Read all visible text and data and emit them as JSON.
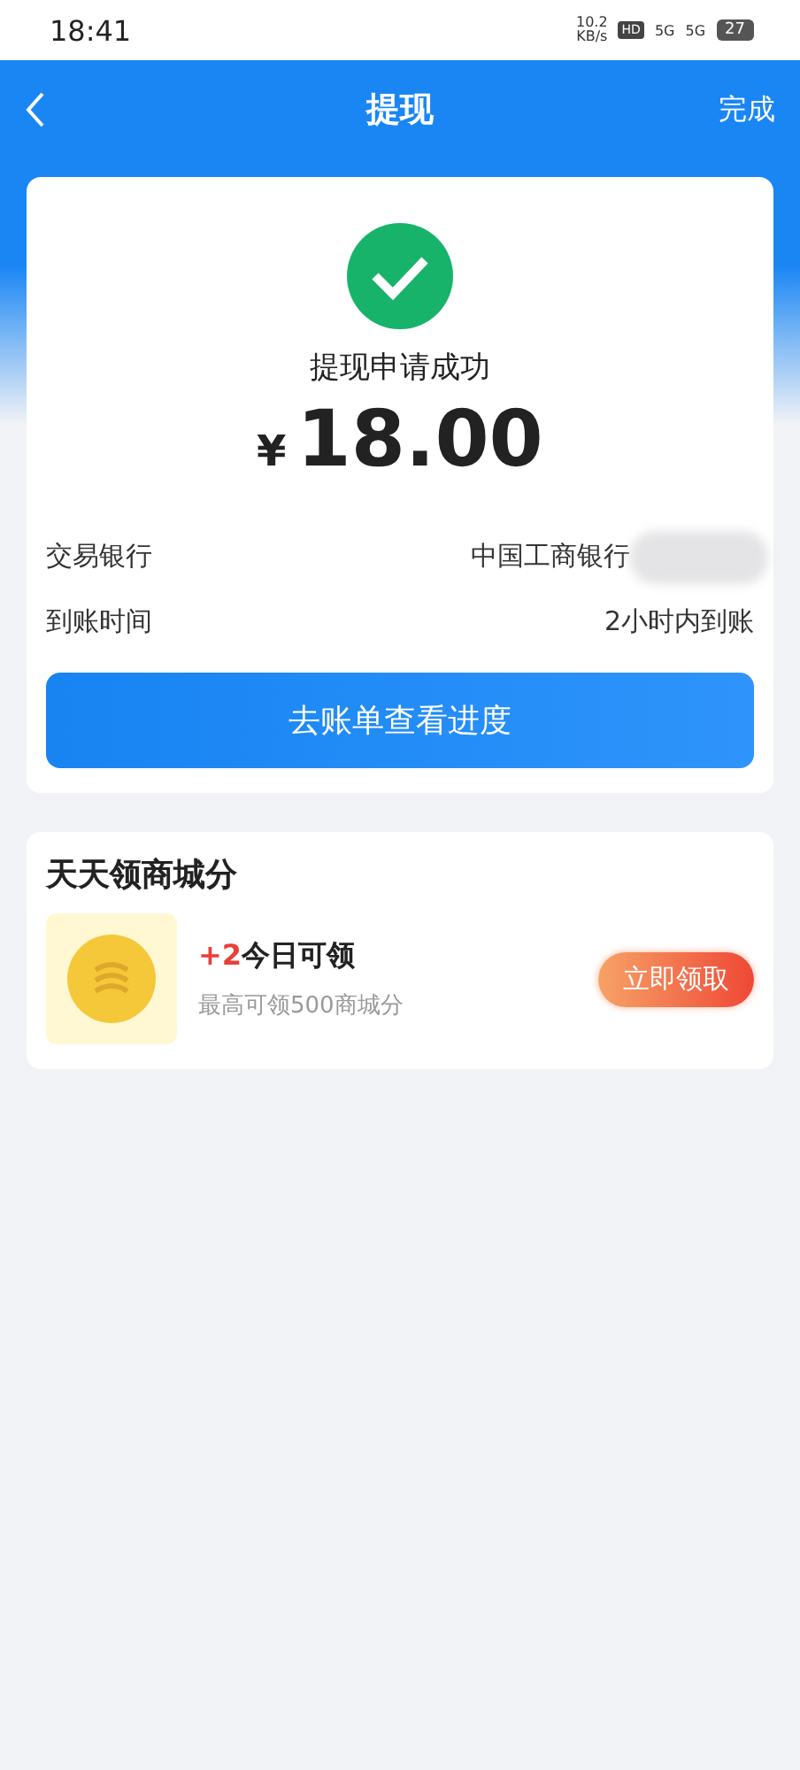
{
  "status_bar": {
    "time": "18:41",
    "speed": "10.2",
    "speed_unit": "KB/s",
    "hd": "HD",
    "signals": [
      "5G",
      "5G"
    ],
    "battery": "27"
  },
  "header": {
    "title": "提现",
    "action": "完成"
  },
  "result": {
    "message": "提现申请成功",
    "currency": "¥",
    "amount": "18.00",
    "rows": [
      {
        "label": "交易银行",
        "value": "中国工商银行",
        "redacted": true
      },
      {
        "label": "到账时间",
        "value": "2小时内到账",
        "redacted": false
      }
    ],
    "button": "去账单查看进度"
  },
  "promo": {
    "title": "天天领商城分",
    "bonus": "+2",
    "label": "今日可领",
    "subtitle": "最高可领500商城分",
    "button": "立即领取"
  }
}
